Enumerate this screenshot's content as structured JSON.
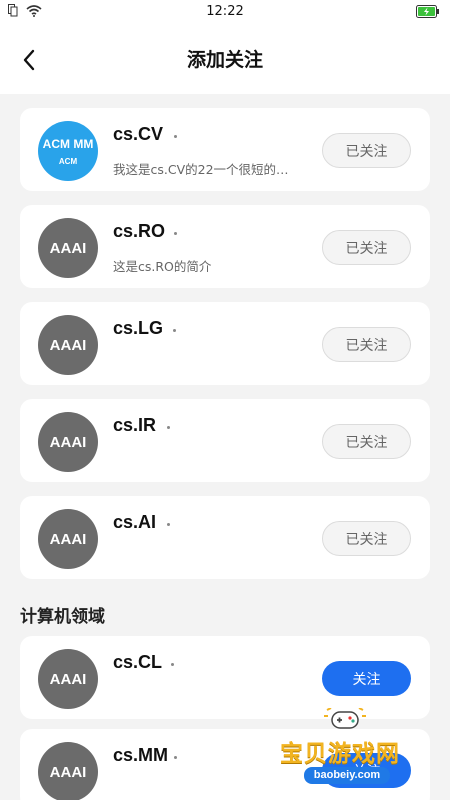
{
  "status_bar": {
    "time": "12:22"
  },
  "nav": {
    "title": "添加关注"
  },
  "followed_list": [
    {
      "name": "cs.CV",
      "avatar_line1": "ACM MM",
      "avatar_line2": "ACM",
      "desc": "我这是cs.CV的22一个很短的…",
      "button": "已关注"
    },
    {
      "name": "cs.RO",
      "avatar": "AAAI",
      "desc": "这是cs.RO的简介",
      "button": "已关注"
    },
    {
      "name": "cs.LG",
      "avatar": "AAAI",
      "desc": "",
      "button": "已关注"
    },
    {
      "name": "cs.IR",
      "avatar": "AAAI",
      "desc": "",
      "button": "已关注"
    },
    {
      "name": "cs.AI",
      "avatar": "AAAI",
      "desc": "",
      "button": "已关注"
    }
  ],
  "section": {
    "title": "计算机领域"
  },
  "domain_list": [
    {
      "name": "cs.CL",
      "avatar": "AAAI",
      "button": "关注"
    },
    {
      "name": "cs.MM",
      "avatar": "AAAI",
      "button": "关注"
    }
  ],
  "watermark": {
    "text": "宝贝游戏网",
    "url": "baobeiy.com"
  },
  "colors": {
    "accent": "#1e6ff0",
    "background": "#f3f3f3",
    "avatar_grey": "#6b6b6b",
    "acm_blue": "#29a3ea"
  }
}
